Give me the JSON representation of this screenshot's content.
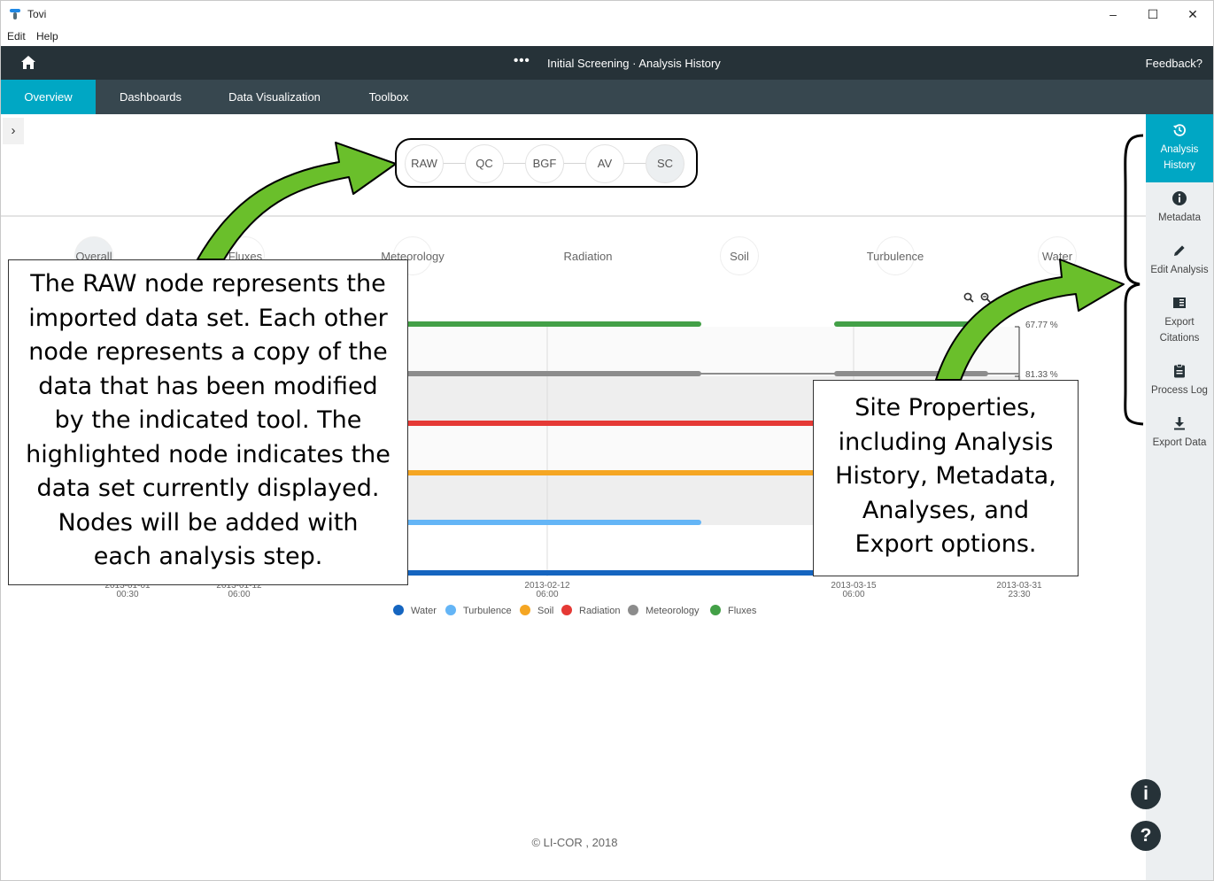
{
  "window": {
    "app_name": "Tovi",
    "minimize": "–",
    "maximize": "☐",
    "close": "✕"
  },
  "menu": {
    "items": [
      "Edit",
      "Help"
    ]
  },
  "header": {
    "title": "Initial Screening · Analysis History",
    "feedback": "Feedback?",
    "more": "•••"
  },
  "tabs": [
    {
      "label": "Overview",
      "active": true
    },
    {
      "label": "Dashboards",
      "active": false
    },
    {
      "label": "Data Visualization",
      "active": false
    },
    {
      "label": "Toolbox",
      "active": false
    }
  ],
  "panel_toggle": "›",
  "nodes": [
    {
      "label": "RAW",
      "current": false
    },
    {
      "label": "QC",
      "current": false
    },
    {
      "label": "BGF",
      "current": false
    },
    {
      "label": "AV",
      "current": false
    },
    {
      "label": "SC",
      "current": true
    }
  ],
  "categories": [
    "Overall",
    "Fluxes",
    "Meteorology",
    "Radiation",
    "Soil",
    "Turbulence",
    "Water"
  ],
  "sidebar": {
    "items": [
      {
        "label": "Analysis History",
        "icon": "history-icon",
        "active": true
      },
      {
        "label": "Metadata",
        "icon": "info-icon",
        "active": false
      },
      {
        "label": "Edit Analysis",
        "icon": "pencil-icon",
        "active": false
      },
      {
        "label": "Export Citations",
        "icon": "citation-icon",
        "active": false
      },
      {
        "label": "Process Log",
        "icon": "clipboard-icon",
        "active": false
      },
      {
        "label": "Export Data",
        "icon": "download-icon",
        "active": false
      }
    ],
    "info_button": "i",
    "help_button": "?"
  },
  "chart_data": {
    "type": "timeline",
    "x_ticks": [
      {
        "date": "2013-01-01",
        "time": "00:30"
      },
      {
        "date": "2013-01-12",
        "time": "06:00"
      },
      {
        "date": "2013-02-12",
        "time": "06:00"
      },
      {
        "date": "2013-03-15",
        "time": "06:00"
      },
      {
        "date": "2013-03-31",
        "time": "23:30"
      }
    ],
    "series": [
      {
        "name": "Fluxes",
        "color": "#43a047",
        "coverage_pct": "67.77 %"
      },
      {
        "name": "Meteorology",
        "color": "#8c8c8c",
        "coverage_pct": "81.33 %"
      },
      {
        "name": "Radiation",
        "color": "#e53935",
        "coverage_pct": ""
      },
      {
        "name": "Soil",
        "color": "#f5a623",
        "coverage_pct": ""
      },
      {
        "name": "Turbulence",
        "color": "#64b5f6",
        "coverage_pct": ""
      },
      {
        "name": "Water",
        "color": "#1565c0",
        "coverage_pct": ""
      }
    ],
    "legend": [
      "Water",
      "Turbulence",
      "Soil",
      "Radiation",
      "Meteorology",
      "Fluxes"
    ]
  },
  "callouts": {
    "left": [
      "The RAW node represents the",
      "imported data set. Each other",
      "node represents a copy of the",
      "data that has been modified",
      "by the indicated tool. The",
      "highlighted node indicates the",
      "data set currently displayed.",
      "Nodes will be added with",
      "each analysis step."
    ],
    "right": [
      "Site Properties,",
      "including Analysis",
      "History, Metadata,",
      "Analyses, and",
      "Export options."
    ]
  },
  "footer": "© LI-COR , 2018"
}
